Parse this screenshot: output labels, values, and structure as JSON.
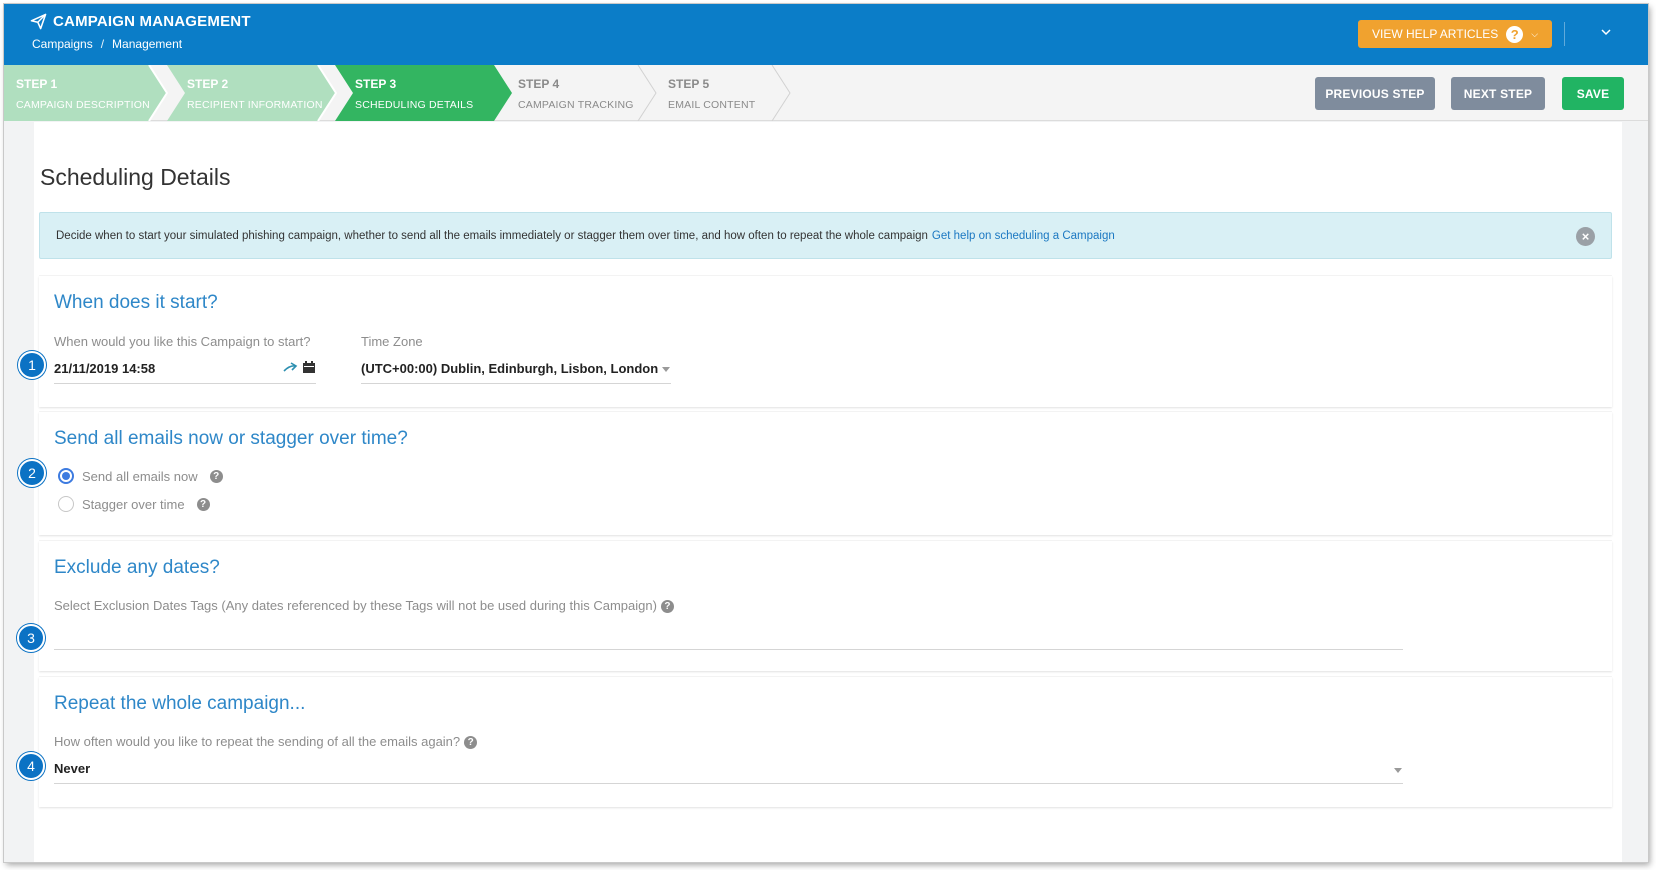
{
  "header": {
    "title": "CAMPAIGN MANAGEMENT",
    "breadcrumb": [
      "Campaigns",
      "/",
      "Management"
    ],
    "help_label": "VIEW HELP ARTICLES",
    "help_symbol": "?"
  },
  "steps": [
    {
      "num": "STEP 1",
      "label": "CAMPAIGN DESCRIPTION",
      "state": "done"
    },
    {
      "num": "STEP 2",
      "label": "RECIPIENT INFORMATION",
      "state": "done"
    },
    {
      "num": "STEP 3",
      "label": "SCHEDULING DETAILS",
      "state": "active"
    },
    {
      "num": "STEP 4",
      "label": "CAMPAIGN TRACKING",
      "state": "todo"
    },
    {
      "num": "STEP 5",
      "label": "EMAIL CONTENT",
      "state": "todo"
    }
  ],
  "actions": {
    "previous": "PREVIOUS STEP",
    "next": "NEXT STEP",
    "save": "SAVE"
  },
  "colors": {
    "header": "#0b7dc8",
    "help": "#f0a22f",
    "step_done": "#b0dfbf",
    "step_active": "#33b561",
    "save": "#21b463",
    "nav_button": "#7f8c9d",
    "section_title": "#2e87c8"
  },
  "page": {
    "title": "Scheduling Details",
    "alert_text": "Decide when to start your simulated phishing campaign, whether to send all the emails immediately or stagger them over time, and how often to repeat the whole campaign",
    "alert_link": "Get help on scheduling a Campaign"
  },
  "start": {
    "title": "When does it start?",
    "date_label": "When would you like this Campaign to start?",
    "date_value": "21/11/2019 14:58",
    "tz_label": "Time Zone",
    "tz_value": "(UTC+00:00) Dublin, Edinburgh, Lisbon, London"
  },
  "send": {
    "title": "Send all emails now or stagger over time?",
    "option_now": "Send all emails now",
    "option_stagger": "Stagger over time",
    "selected": "now"
  },
  "exclude": {
    "title": "Exclude any dates?",
    "label": "Select Exclusion Dates Tags (Any dates referenced by these Tags will not be used during this Campaign)"
  },
  "repeat": {
    "title": "Repeat the whole campaign...",
    "label": "How often would you like to repeat the sending of all the emails again?",
    "value": "Never"
  },
  "badges": [
    "1",
    "2",
    "3",
    "4"
  ],
  "icons": [
    "paper-plane-icon",
    "question-icon",
    "chevron-down-icon",
    "pin-icon",
    "calendar-icon",
    "close-icon",
    "caret-down-icon"
  ]
}
